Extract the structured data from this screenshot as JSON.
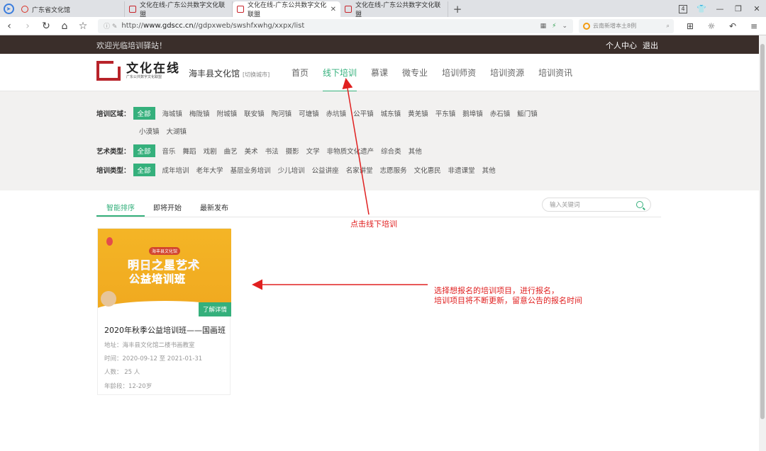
{
  "browser": {
    "tabs": [
      {
        "title": "广东省文化馆",
        "active": false
      },
      {
        "title": "文化在线-广东公共数字文化联盟",
        "active": false
      },
      {
        "title": "文化在线-广东公共数字文化联盟",
        "active": true
      },
      {
        "title": "文化在线-广东公共数字文化联盟",
        "active": false
      }
    ],
    "url_scheme": "http://",
    "url_host": "www.gdscc.cn",
    "url_path": "//gdpxweb/swshfxwhg/xxpx/list",
    "search_placeholder": "云南新增本土8例",
    "window_badge": "4"
  },
  "topbar": {
    "welcome": "欢迎光临培训驿站！",
    "user_center": "个人中心",
    "logout": "退出"
  },
  "header": {
    "logo_title": "文化在线",
    "logo_sub": "广东公共数字文化联盟",
    "site_name": "海丰县文化馆",
    "switch_city": "[切换城市]",
    "nav": [
      "首页",
      "线下培训",
      "慕课",
      "微专业",
      "培训师资",
      "培训资源",
      "培训资讯"
    ],
    "active_nav": "线下培训"
  },
  "filters": {
    "area_label": "培训区域：",
    "area_all": "全部",
    "area_row1": [
      "海城镇",
      "梅陇镇",
      "附城镇",
      "联安镇",
      "陶河镇",
      "可塘镇",
      "赤坑镇",
      "公平镇",
      "城东镇",
      "黄羌镇",
      "平东镇",
      "鹅埠镇",
      "赤石镇",
      "鮜门镇"
    ],
    "area_row2": [
      "小漠镇",
      "大湖镇"
    ],
    "art_label": "艺术类型：",
    "art_all": "全部",
    "art_options": [
      "音乐",
      "舞蹈",
      "戏剧",
      "曲艺",
      "美术",
      "书法",
      "摄影",
      "文学",
      "非物质文化遗产",
      "综合类",
      "其他"
    ],
    "train_label": "培训类型：",
    "train_all": "全部",
    "train_options": [
      "成年培训",
      "老年大学",
      "基层业务培训",
      "少儿培训",
      "公益讲座",
      "名家讲堂",
      "志愿服务",
      "文化惠民",
      "非遗课堂",
      "其他"
    ]
  },
  "sort": {
    "tabs": [
      "智能排序",
      "即将开始",
      "最新发布"
    ],
    "active": "智能排序",
    "keyword_placeholder": "输入关键词"
  },
  "card": {
    "poster_tag": "海丰县文化馆",
    "poster_line1": "明日之星艺术",
    "poster_line2": "公益培训班",
    "more": "了解详情",
    "title": "2020年秋季公益培训班——国画班",
    "address": "地址：海丰县文化馆二楼书画教室",
    "time": "时间：2020-09-12 至 2021-01-31",
    "people": "人数： 25 人",
    "age": "年龄段：12-20岁"
  },
  "annotations": {
    "click_note": "点击线下培训",
    "select_note_1": "选择想报名的培训项目，进行报名，",
    "select_note_2": "培训项目将不断更新，留意公告的报名时间"
  },
  "colors": {
    "accent": "#35b07c",
    "topbar": "#3a2e2a",
    "brand_red": "#b8232a",
    "annotation_red": "#e02020"
  }
}
